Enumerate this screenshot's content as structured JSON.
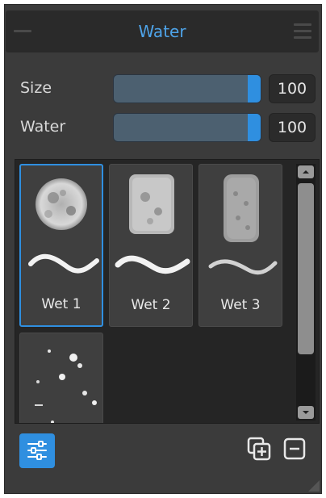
{
  "panel": {
    "title": "Water",
    "colors": {
      "accent": "#2f8fe0",
      "title": "#4ea3e8",
      "background": "#3b3b3b"
    },
    "icons": [
      "minimize-icon",
      "menu-icon",
      "brush-settings-icon",
      "duplicate-brush-icon",
      "remove-brush-icon",
      "resize-grip-icon"
    ]
  },
  "controls": {
    "size": {
      "label": "Size",
      "value": "100",
      "level_percent": 100
    },
    "water": {
      "label": "Water",
      "value": "100",
      "level_percent": 100
    }
  },
  "presets": {
    "items": [
      {
        "label": "Wet 1",
        "selected": true
      },
      {
        "label": "Wet 2",
        "selected": false
      },
      {
        "label": "Wet 3",
        "selected": false
      },
      {
        "label": "",
        "selected": false
      }
    ]
  }
}
